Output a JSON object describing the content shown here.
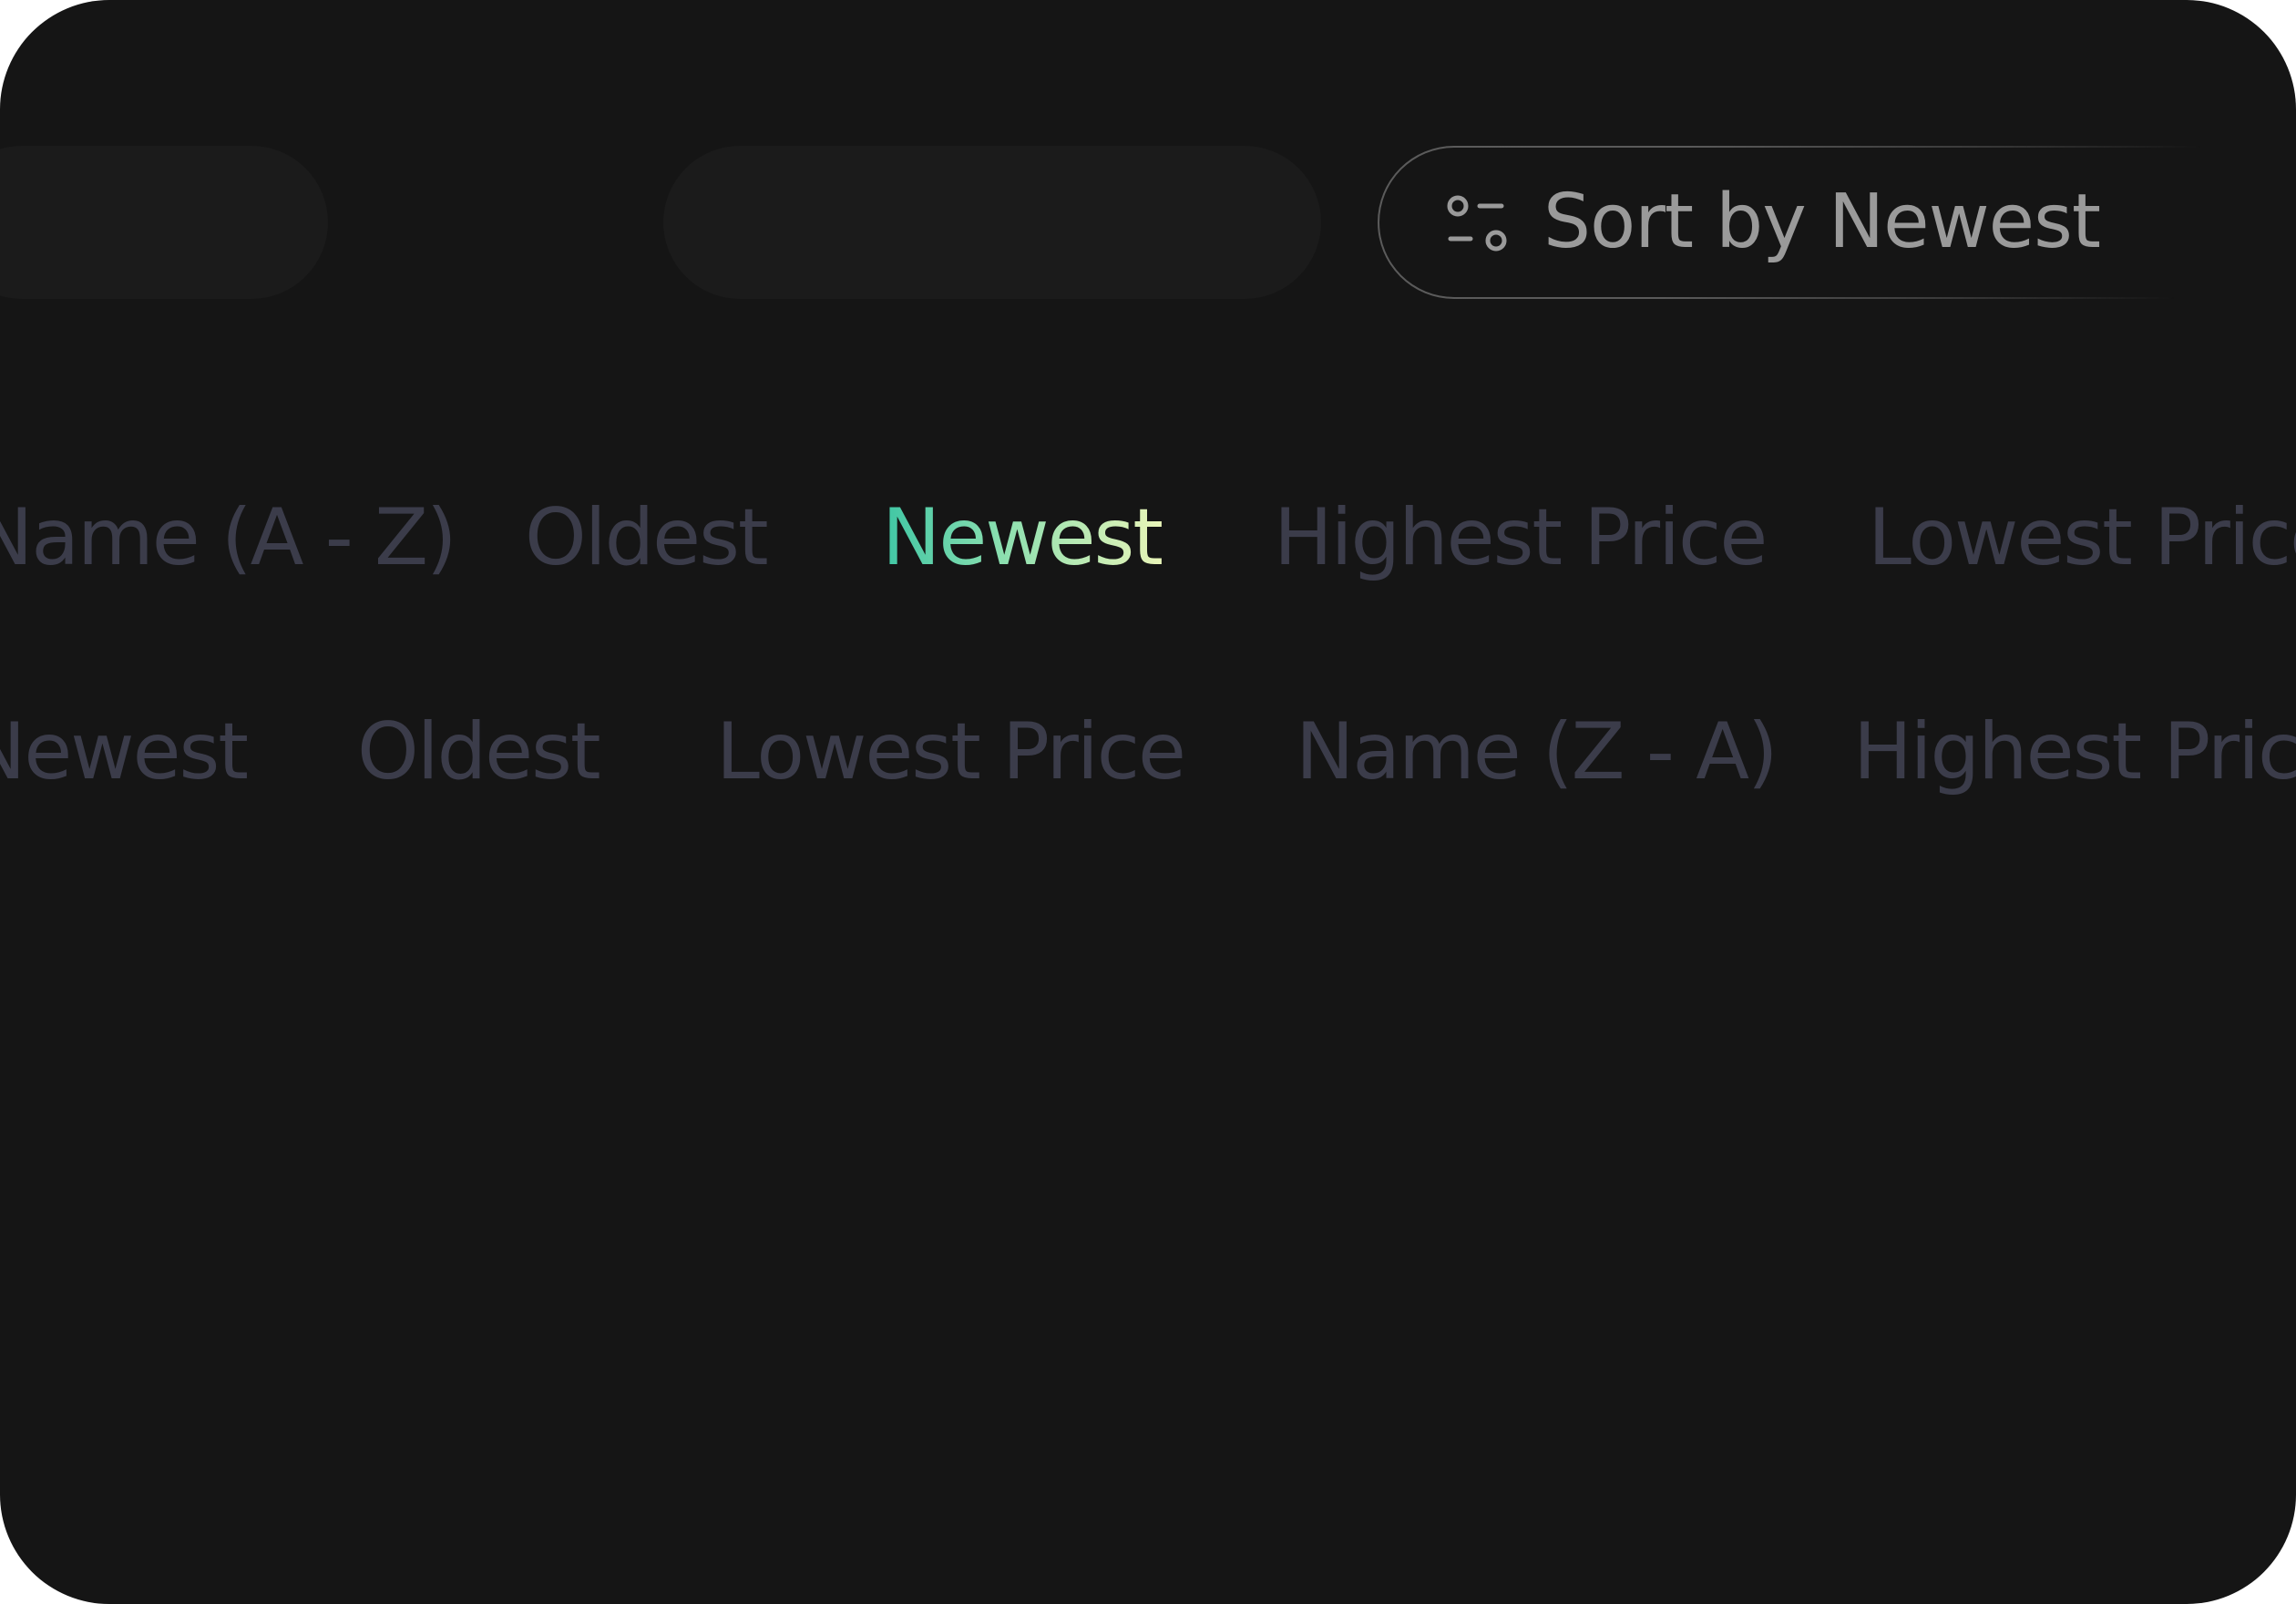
{
  "colors": {
    "background": "#151515",
    "placeholder_pill": "#1b1b1b",
    "option_text": "#3b3c4a",
    "sort_text": "#9a9a9a",
    "active_gradient_start": "#3fc6a4",
    "active_gradient_end": "#e8f4b8"
  },
  "sort_button": {
    "icon": "sliders-icon",
    "label_prefix": "Sort by",
    "label_value": "Newest"
  },
  "sort_options_row_1": [
    {
      "label": "Name (A - Z)",
      "active": false
    },
    {
      "label": "Oldest",
      "active": false
    },
    {
      "label": "Newest",
      "active": true
    },
    {
      "label": "Highest Price",
      "active": false
    },
    {
      "label": "Lowest Price",
      "active": false
    }
  ],
  "sort_options_row_2": [
    {
      "label": "Newest",
      "active": false
    },
    {
      "label": "Oldest",
      "active": false
    },
    {
      "label": "Lowest Price",
      "active": false
    },
    {
      "label": "Name (Z - A)",
      "active": false
    },
    {
      "label": "Highest Price",
      "active": false
    }
  ]
}
